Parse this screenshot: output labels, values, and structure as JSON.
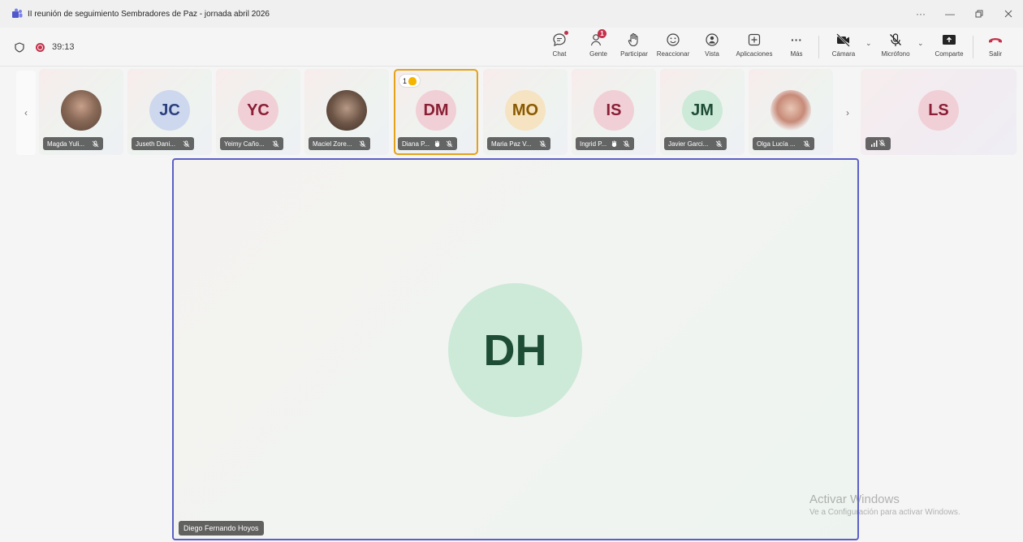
{
  "window": {
    "title": "II reunión de seguimiento Sembradores de Paz - jornada abril 2026",
    "controls": [
      "more-icon",
      "minimize-icon",
      "restore-icon",
      "close-icon"
    ]
  },
  "toolbar": {
    "timer": "39:13",
    "recording": true,
    "buttons": {
      "chat": "Chat",
      "people": "Gente",
      "people_badge": "1",
      "raise": "Participar",
      "react": "Reaccionar",
      "view": "Vista",
      "apps": "Aplicaciones",
      "more": "Más",
      "camera": "Cámara",
      "mic": "Micrófono",
      "share": "Comparte",
      "leave": "Salir"
    }
  },
  "participants": [
    {
      "name": "Magda Yuli...",
      "initials": "",
      "photo": true,
      "color": "",
      "bg": "",
      "hand": false
    },
    {
      "name": "Juseth Dani...",
      "initials": "JC",
      "photo": false,
      "color": "#2b3f7e",
      "bg": "#cdd8ee",
      "hand": false
    },
    {
      "name": "Yeimy Caño...",
      "initials": "YC",
      "photo": false,
      "color": "#8a1f35",
      "bg": "#f1cfd6",
      "hand": false
    },
    {
      "name": "Maciel Zore...",
      "initials": "",
      "photo": true,
      "color": "",
      "bg": "",
      "hand": false
    },
    {
      "name": "Diana P...",
      "initials": "DM",
      "photo": false,
      "color": "#8a1f35",
      "bg": "#f1cfd6",
      "hand": true,
      "hand_count": "1",
      "active": true
    },
    {
      "name": "Maria Paz V...",
      "initials": "MO",
      "photo": false,
      "color": "#8a5a00",
      "bg": "#f6e3c1",
      "hand": false
    },
    {
      "name": "Ingrid P...",
      "initials": "IS",
      "photo": false,
      "color": "#8a1f35",
      "bg": "#f1cfd6",
      "hand": false,
      "raise_icon": true
    },
    {
      "name": "Javier Garci...",
      "initials": "JM",
      "photo": false,
      "color": "#1e4d36",
      "bg": "#cde9d8",
      "hand": false
    },
    {
      "name": "Olga Lucía ...",
      "initials": "",
      "photo": true,
      "color": "",
      "bg": "",
      "hand": false
    }
  ],
  "overflow_tile": {
    "initials": "LS",
    "color": "#8a1f35",
    "bg": "#f1cfd6"
  },
  "main_speaker": {
    "initials": "DH",
    "name": "Diego Fernando Hoyos"
  },
  "watermark": {
    "title": "Activar Windows",
    "subtitle": "Ve a Configuración para activar Windows."
  }
}
